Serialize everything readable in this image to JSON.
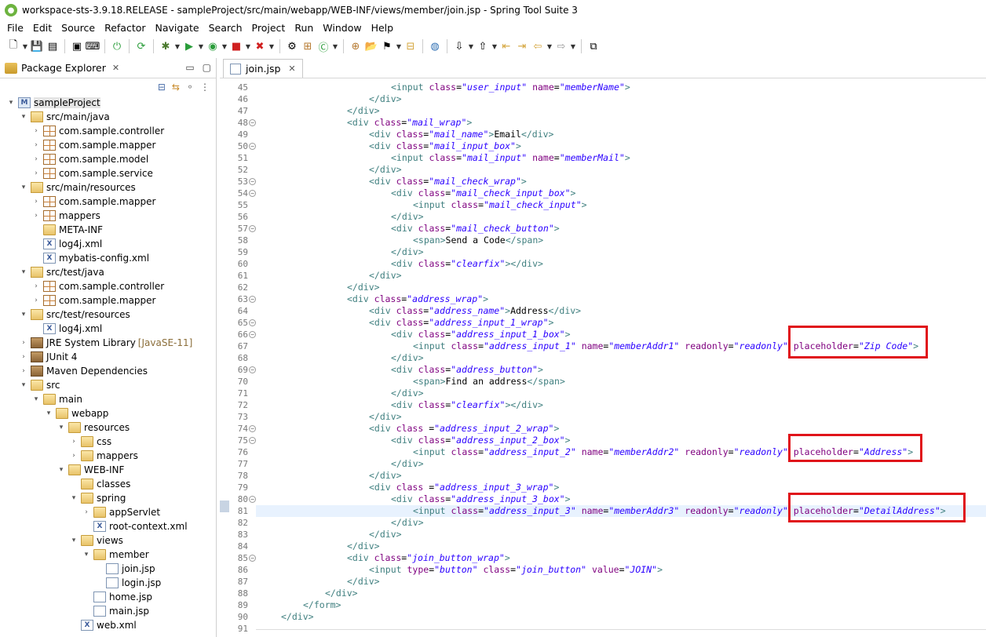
{
  "window": {
    "title": "workspace-sts-3.9.18.RELEASE - sampleProject/src/main/webapp/WEB-INF/views/member/join.jsp - Spring Tool Suite 3"
  },
  "menu": [
    "File",
    "Edit",
    "Source",
    "Refactor",
    "Navigate",
    "Search",
    "Project",
    "Run",
    "Window",
    "Help"
  ],
  "package_explorer": {
    "tab_label": "Package Explorer",
    "tree": [
      {
        "depth": 0,
        "label": "sampleProject",
        "icon": "project-icon",
        "toggle": "expanded",
        "selected": true
      },
      {
        "depth": 1,
        "label": "src/main/java",
        "icon": "source-folder-icon",
        "toggle": "expanded"
      },
      {
        "depth": 2,
        "label": "com.sample.controller",
        "icon": "package-icon",
        "toggle": "collapsed"
      },
      {
        "depth": 2,
        "label": "com.sample.mapper",
        "icon": "package-icon",
        "toggle": "collapsed"
      },
      {
        "depth": 2,
        "label": "com.sample.model",
        "icon": "package-icon",
        "toggle": "collapsed"
      },
      {
        "depth": 2,
        "label": "com.sample.service",
        "icon": "package-icon",
        "toggle": "collapsed"
      },
      {
        "depth": 1,
        "label": "src/main/resources",
        "icon": "source-folder-icon",
        "toggle": "expanded"
      },
      {
        "depth": 2,
        "label": "com.sample.mapper",
        "icon": "package-icon",
        "toggle": "collapsed"
      },
      {
        "depth": 2,
        "label": "mappers",
        "icon": "package-icon",
        "toggle": "collapsed"
      },
      {
        "depth": 2,
        "label": "META-INF",
        "icon": "folder-icon",
        "toggle": "none"
      },
      {
        "depth": 2,
        "label": "log4j.xml",
        "icon": "xml-file-icon",
        "toggle": "none"
      },
      {
        "depth": 2,
        "label": "mybatis-config.xml",
        "icon": "xml-file-icon",
        "toggle": "none"
      },
      {
        "depth": 1,
        "label": "src/test/java",
        "icon": "source-folder-icon",
        "toggle": "expanded"
      },
      {
        "depth": 2,
        "label": "com.sample.controller",
        "icon": "package-icon",
        "toggle": "collapsed"
      },
      {
        "depth": 2,
        "label": "com.sample.mapper",
        "icon": "package-icon",
        "toggle": "collapsed"
      },
      {
        "depth": 1,
        "label": "src/test/resources",
        "icon": "source-folder-icon",
        "toggle": "expanded"
      },
      {
        "depth": 2,
        "label": "log4j.xml",
        "icon": "xml-file-icon",
        "toggle": "none"
      },
      {
        "depth": 1,
        "label": "JRE System Library",
        "decoration": "[JavaSE-11]",
        "icon": "library-icon",
        "toggle": "collapsed"
      },
      {
        "depth": 1,
        "label": "JUnit 4",
        "icon": "library-icon",
        "toggle": "collapsed"
      },
      {
        "depth": 1,
        "label": "Maven Dependencies",
        "icon": "library-icon",
        "toggle": "collapsed"
      },
      {
        "depth": 1,
        "label": "src",
        "icon": "folder-icon",
        "toggle": "expanded"
      },
      {
        "depth": 2,
        "label": "main",
        "icon": "folder-icon",
        "toggle": "expanded"
      },
      {
        "depth": 3,
        "label": "webapp",
        "icon": "folder-icon",
        "toggle": "expanded"
      },
      {
        "depth": 4,
        "label": "resources",
        "icon": "folder-icon",
        "toggle": "expanded"
      },
      {
        "depth": 5,
        "label": "css",
        "icon": "folder-icon",
        "toggle": "collapsed"
      },
      {
        "depth": 5,
        "label": "mappers",
        "icon": "folder-icon",
        "toggle": "collapsed"
      },
      {
        "depth": 4,
        "label": "WEB-INF",
        "icon": "folder-icon",
        "toggle": "expanded"
      },
      {
        "depth": 5,
        "label": "classes",
        "icon": "folder-icon",
        "toggle": "none"
      },
      {
        "depth": 5,
        "label": "spring",
        "icon": "folder-icon",
        "toggle": "expanded"
      },
      {
        "depth": 6,
        "label": "appServlet",
        "icon": "folder-icon",
        "toggle": "collapsed"
      },
      {
        "depth": 6,
        "label": "root-context.xml",
        "icon": "xml-file-icon",
        "toggle": "none"
      },
      {
        "depth": 5,
        "label": "views",
        "icon": "folder-icon",
        "toggle": "expanded"
      },
      {
        "depth": 6,
        "label": "member",
        "icon": "folder-icon",
        "toggle": "expanded"
      },
      {
        "depth": 7,
        "label": "join.jsp",
        "icon": "file-icon",
        "toggle": "none"
      },
      {
        "depth": 7,
        "label": "login.jsp",
        "icon": "file-icon",
        "toggle": "none"
      },
      {
        "depth": 6,
        "label": "home.jsp",
        "icon": "file-icon",
        "toggle": "none"
      },
      {
        "depth": 6,
        "label": "main.jsp",
        "icon": "file-icon",
        "toggle": "none"
      },
      {
        "depth": 5,
        "label": "web.xml",
        "icon": "xml-file-icon",
        "toggle": "none"
      }
    ]
  },
  "editor": {
    "tab_label": "join.jsp",
    "current_line": 81,
    "lines": [
      {
        "n": 45,
        "fold": false,
        "indent": 24,
        "html": "<span class=\"tk-tag\">&lt;input</span> <span class=\"tk-attr\">class</span>=<span class=\"tk-val\">\"user_input\"</span> <span class=\"tk-attr\">name</span>=<span class=\"tk-val\">\"memberName\"</span><span class=\"tk-tag\">&gt;</span>"
      },
      {
        "n": 46,
        "fold": false,
        "indent": 20,
        "html": "<span class=\"tk-tag\">&lt;/div&gt;</span>"
      },
      {
        "n": 47,
        "fold": false,
        "indent": 16,
        "html": "<span class=\"tk-tag\">&lt;/div&gt;</span>"
      },
      {
        "n": 48,
        "fold": true,
        "indent": 16,
        "html": "<span class=\"tk-tag\">&lt;div</span> <span class=\"tk-attr\">class</span>=<span class=\"tk-val\">\"mail_wrap\"</span><span class=\"tk-tag\">&gt;</span>"
      },
      {
        "n": 49,
        "fold": false,
        "indent": 20,
        "html": "<span class=\"tk-tag\">&lt;div</span> <span class=\"tk-attr\">class</span>=<span class=\"tk-val\">\"mail_name\"</span><span class=\"tk-tag\">&gt;</span>Email<span class=\"tk-tag\">&lt;/div&gt;</span>"
      },
      {
        "n": 50,
        "fold": true,
        "indent": 20,
        "html": "<span class=\"tk-tag\">&lt;div</span> <span class=\"tk-attr\">class</span>=<span class=\"tk-val\">\"mail_input_box\"</span><span class=\"tk-tag\">&gt;</span>"
      },
      {
        "n": 51,
        "fold": false,
        "indent": 24,
        "html": "<span class=\"tk-tag\">&lt;input</span> <span class=\"tk-attr\">class</span>=<span class=\"tk-val\">\"mail_input\"</span> <span class=\"tk-attr\">name</span>=<span class=\"tk-val\">\"memberMail\"</span><span class=\"tk-tag\">&gt;</span>"
      },
      {
        "n": 52,
        "fold": false,
        "indent": 20,
        "html": "<span class=\"tk-tag\">&lt;/div&gt;</span>"
      },
      {
        "n": 53,
        "fold": true,
        "indent": 20,
        "html": "<span class=\"tk-tag\">&lt;div</span> <span class=\"tk-attr\">class</span>=<span class=\"tk-val\">\"mail_check_wrap\"</span><span class=\"tk-tag\">&gt;</span>"
      },
      {
        "n": 54,
        "fold": true,
        "indent": 24,
        "html": "<span class=\"tk-tag\">&lt;div</span> <span class=\"tk-attr\">class</span>=<span class=\"tk-val\">\"mail_check_input_box\"</span><span class=\"tk-tag\">&gt;</span>"
      },
      {
        "n": 55,
        "fold": false,
        "indent": 28,
        "html": "<span class=\"tk-tag\">&lt;input</span> <span class=\"tk-attr\">class</span>=<span class=\"tk-val\">\"mail_check_input\"</span><span class=\"tk-tag\">&gt;</span>"
      },
      {
        "n": 56,
        "fold": false,
        "indent": 24,
        "html": "<span class=\"tk-tag\">&lt;/div&gt;</span>"
      },
      {
        "n": 57,
        "fold": true,
        "indent": 24,
        "html": "<span class=\"tk-tag\">&lt;div</span> <span class=\"tk-attr\">class</span>=<span class=\"tk-val\">\"mail_check_button\"</span><span class=\"tk-tag\">&gt;</span>"
      },
      {
        "n": 58,
        "fold": false,
        "indent": 28,
        "html": "<span class=\"tk-tag\">&lt;span&gt;</span>Send a Code<span class=\"tk-tag\">&lt;/span&gt;</span>"
      },
      {
        "n": 59,
        "fold": false,
        "indent": 24,
        "html": "<span class=\"tk-tag\">&lt;/div&gt;</span>"
      },
      {
        "n": 60,
        "fold": false,
        "indent": 24,
        "html": "<span class=\"tk-tag\">&lt;div</span> <span class=\"tk-attr\">class</span>=<span class=\"tk-val\">\"clearfix\"</span><span class=\"tk-tag\">&gt;&lt;/div&gt;</span>"
      },
      {
        "n": 61,
        "fold": false,
        "indent": 20,
        "html": "<span class=\"tk-tag\">&lt;/div&gt;</span>"
      },
      {
        "n": 62,
        "fold": false,
        "indent": 16,
        "html": "<span class=\"tk-tag\">&lt;/div&gt;</span>"
      },
      {
        "n": 63,
        "fold": true,
        "indent": 16,
        "html": "<span class=\"tk-tag\">&lt;div</span> <span class=\"tk-attr\">class</span>=<span class=\"tk-val\">\"address_wrap\"</span><span class=\"tk-tag\">&gt;</span>"
      },
      {
        "n": 64,
        "fold": false,
        "indent": 20,
        "html": "<span class=\"tk-tag\">&lt;div</span> <span class=\"tk-attr\">class</span>=<span class=\"tk-val\">\"address_name\"</span><span class=\"tk-tag\">&gt;</span>Address<span class=\"tk-tag\">&lt;/div&gt;</span>"
      },
      {
        "n": 65,
        "fold": true,
        "indent": 20,
        "html": "<span class=\"tk-tag\">&lt;div</span> <span class=\"tk-attr\">class</span>=<span class=\"tk-val\">\"address_input_1_wrap\"</span><span class=\"tk-tag\">&gt;</span>"
      },
      {
        "n": 66,
        "fold": true,
        "indent": 24,
        "html": "<span class=\"tk-tag\">&lt;div</span> <span class=\"tk-attr\">class</span>=<span class=\"tk-val\">\"address_input_1_box\"</span><span class=\"tk-tag\">&gt;</span>"
      },
      {
        "n": 67,
        "fold": false,
        "indent": 28,
        "html": "<span class=\"tk-tag\">&lt;input</span> <span class=\"tk-attr\">class</span>=<span class=\"tk-val\">\"address_input_1\"</span> <span class=\"tk-attr\">name</span>=<span class=\"tk-val\">\"memberAddr1\"</span> <span class=\"tk-attr\">readonly</span>=<span class=\"tk-val\">\"readonly\"</span> <span class=\"tk-attr\">placeholder</span>=<span class=\"tk-val\">\"Zip Code\"</span><span class=\"tk-tag\">&gt;</span>"
      },
      {
        "n": 68,
        "fold": false,
        "indent": 24,
        "html": "<span class=\"tk-tag\">&lt;/div&gt;</span>"
      },
      {
        "n": 69,
        "fold": true,
        "indent": 24,
        "html": "<span class=\"tk-tag\">&lt;div</span> <span class=\"tk-attr\">class</span>=<span class=\"tk-val\">\"address_button\"</span><span class=\"tk-tag\">&gt;</span>"
      },
      {
        "n": 70,
        "fold": false,
        "indent": 28,
        "html": "<span class=\"tk-tag\">&lt;span&gt;</span>Find an address<span class=\"tk-tag\">&lt;/span&gt;</span>"
      },
      {
        "n": 71,
        "fold": false,
        "indent": 24,
        "html": "<span class=\"tk-tag\">&lt;/div&gt;</span>"
      },
      {
        "n": 72,
        "fold": false,
        "indent": 24,
        "html": "<span class=\"tk-tag\">&lt;div</span> <span class=\"tk-attr\">class</span>=<span class=\"tk-val\">\"clearfix\"</span><span class=\"tk-tag\">&gt;&lt;/div&gt;</span>"
      },
      {
        "n": 73,
        "fold": false,
        "indent": 20,
        "html": "<span class=\"tk-tag\">&lt;/div&gt;</span>"
      },
      {
        "n": 74,
        "fold": true,
        "indent": 20,
        "html": "<span class=\"tk-tag\">&lt;div</span> <span class=\"tk-attr\">class</span> =<span class=\"tk-val\">\"address_input_2_wrap\"</span><span class=\"tk-tag\">&gt;</span>"
      },
      {
        "n": 75,
        "fold": true,
        "indent": 24,
        "html": "<span class=\"tk-tag\">&lt;div</span> <span class=\"tk-attr\">class</span>=<span class=\"tk-val\">\"address_input_2_box\"</span><span class=\"tk-tag\">&gt;</span>"
      },
      {
        "n": 76,
        "fold": false,
        "indent": 28,
        "html": "<span class=\"tk-tag\">&lt;input</span> <span class=\"tk-attr\">class</span>=<span class=\"tk-val\">\"address_input_2\"</span> <span class=\"tk-attr\">name</span>=<span class=\"tk-val\">\"memberAddr2\"</span> <span class=\"tk-attr\">readonly</span>=<span class=\"tk-val\">\"readonly\"</span> <span class=\"tk-attr\">placeholder</span>=<span class=\"tk-val\">\"Address\"</span><span class=\"tk-tag\">&gt;</span>"
      },
      {
        "n": 77,
        "fold": false,
        "indent": 24,
        "html": "<span class=\"tk-tag\">&lt;/div&gt;</span>"
      },
      {
        "n": 78,
        "fold": false,
        "indent": 20,
        "html": "<span class=\"tk-tag\">&lt;/div&gt;</span>"
      },
      {
        "n": 79,
        "fold": false,
        "indent": 20,
        "html": "<span class=\"tk-tag\">&lt;div</span> <span class=\"tk-attr\">class</span> =<span class=\"tk-val\">\"address_input_3_wrap\"</span><span class=\"tk-tag\">&gt;</span>"
      },
      {
        "n": 80,
        "fold": true,
        "indent": 24,
        "html": "<span class=\"tk-tag\">&lt;div</span> <span class=\"tk-attr\">class</span>=<span class=\"tk-val\">\"address_input_3_box\"</span><span class=\"tk-tag\">&gt;</span>"
      },
      {
        "n": 81,
        "fold": false,
        "indent": 28,
        "html": "<span class=\"tk-tag\">&lt;input</span> <span class=\"tk-attr\">class</span>=<span class=\"tk-val\">\"address_input_3\"</span> <span class=\"tk-attr\">name</span>=<span class=\"tk-val\">\"memberAddr3\"</span> <span class=\"tk-attr\">readonly</span>=<span class=\"tk-val\">\"readonly\"</span> <span class=\"tk-attr\">placeholder</span>=<span class=\"tk-val\">\"DetailAddress\"</span><span class=\"tk-tag\">&gt;</span>"
      },
      {
        "n": 82,
        "fold": false,
        "indent": 24,
        "html": "<span class=\"tk-tag\">&lt;/div&gt;</span>"
      },
      {
        "n": 83,
        "fold": false,
        "indent": 20,
        "html": "<span class=\"tk-tag\">&lt;/div&gt;</span>"
      },
      {
        "n": 84,
        "fold": false,
        "indent": 16,
        "html": "<span class=\"tk-tag\">&lt;/div&gt;</span>"
      },
      {
        "n": 85,
        "fold": true,
        "indent": 16,
        "html": "<span class=\"tk-tag\">&lt;div</span> <span class=\"tk-attr\">class</span>=<span class=\"tk-val\">\"join_button_wrap\"</span><span class=\"tk-tag\">&gt;</span>"
      },
      {
        "n": 86,
        "fold": false,
        "indent": 20,
        "html": "<span class=\"tk-tag\">&lt;input</span> <span class=\"tk-attr\">type</span>=<span class=\"tk-val\">\"button\"</span> <span class=\"tk-attr\">class</span>=<span class=\"tk-val\">\"join_button\"</span> <span class=\"tk-attr\">value</span>=<span class=\"tk-val\">\"JOIN\"</span><span class=\"tk-tag\">&gt;</span>"
      },
      {
        "n": 87,
        "fold": false,
        "indent": 16,
        "html": "<span class=\"tk-tag\">&lt;/div&gt;</span>"
      },
      {
        "n": 88,
        "fold": false,
        "indent": 12,
        "html": "<span class=\"tk-tag\">&lt;/div&gt;</span>"
      },
      {
        "n": 89,
        "fold": false,
        "indent": 8,
        "html": "<span class=\"tk-tag\">&lt;/form&gt;</span>"
      },
      {
        "n": 90,
        "fold": false,
        "indent": 4,
        "html": "<span class=\"tk-tag\">&lt;/div&gt;</span>"
      },
      {
        "n": 91,
        "fold": false,
        "indent": 0,
        "html": ""
      }
    ]
  },
  "colors": {
    "highlight_box": "#e0131a",
    "tag": "#3f7f7f",
    "attribute": "#7f007f",
    "value": "#2a00ff",
    "current_line": "#e8f2fe"
  }
}
